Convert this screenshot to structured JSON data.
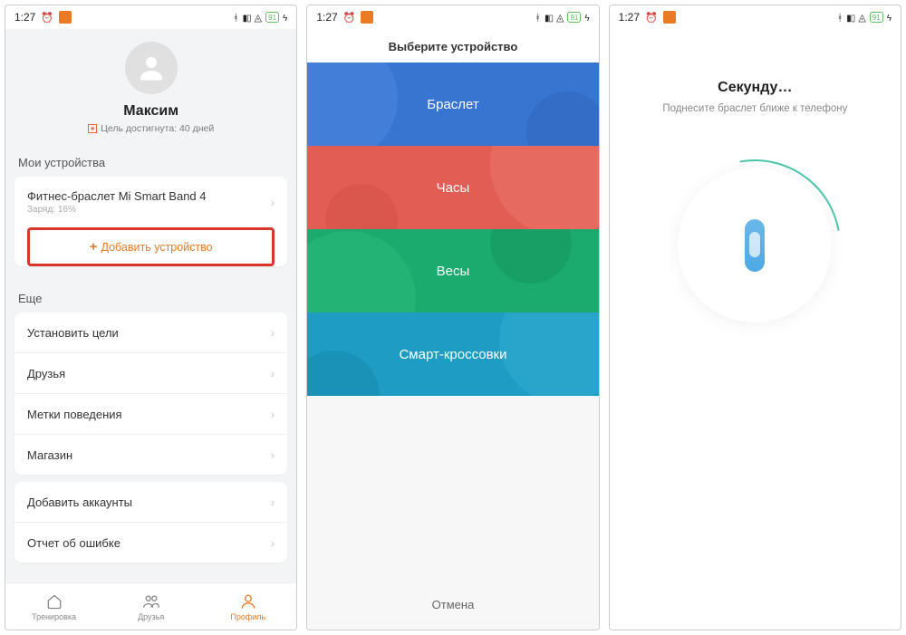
{
  "status": {
    "time": "1:27",
    "battery": "91"
  },
  "p1": {
    "username": "Максим",
    "goal": "Цель достигнута: 40 дней",
    "section_devices": "Мои устройства",
    "device_name": "Фитнес-браслет Mi Smart Band 4",
    "device_charge": "Заряд: 16%",
    "add_device": "Добавить устройство",
    "section_more": "Еще",
    "more": {
      "goals": "Установить цели",
      "friends": "Друзья",
      "behavior": "Метки поведения",
      "store": "Магазин",
      "accounts": "Добавить аккаунты",
      "report": "Отчет об ошибке"
    },
    "nav": {
      "workout": "Тренировка",
      "friends": "Друзья",
      "profile": "Профиль"
    }
  },
  "p2": {
    "header": "Выберите устройство",
    "tiles": {
      "band": "Браслет",
      "watch": "Часы",
      "scale": "Весы",
      "shoes": "Смарт-кроссовки"
    },
    "cancel": "Отмена"
  },
  "p3": {
    "title": "Секунду…",
    "subtitle": "Поднесите браслет ближе к телефону"
  }
}
